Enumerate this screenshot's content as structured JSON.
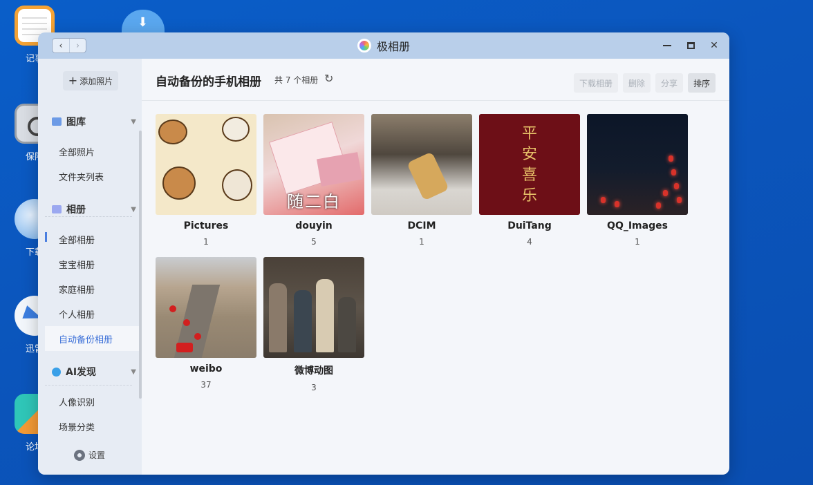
{
  "desktop": {
    "icons": [
      {
        "label": "记事"
      },
      {
        "label": "保险"
      },
      {
        "label": "下载"
      },
      {
        "label": "迅雷"
      },
      {
        "label": "论坛"
      }
    ]
  },
  "window": {
    "title": "极相册",
    "nav": {
      "back": "‹",
      "forward": "›"
    },
    "controls": {
      "close": "✕"
    }
  },
  "sidebar": {
    "add_label": "添加照片",
    "sections": [
      {
        "title": "图库",
        "items": [
          "全部照片",
          "文件夹列表"
        ]
      },
      {
        "title": "相册",
        "items": [
          "全部相册",
          "宝宝相册",
          "家庭相册",
          "个人相册",
          "自动备份相册"
        ]
      },
      {
        "title": "AI发现",
        "items": [
          "人像识别",
          "场景分类"
        ]
      }
    ],
    "active_item": "自动备份相册",
    "settings_label": "设置"
  },
  "main": {
    "title": "自动备份的手机相册",
    "count_text": "共 7 个相册",
    "toolbar": {
      "download": "下载相册",
      "delete": "删除",
      "share": "分享",
      "sort": "排序"
    },
    "albums": [
      {
        "name": "Pictures",
        "count": "1"
      },
      {
        "name": "douyin",
        "count": "5",
        "caption": "随二白"
      },
      {
        "name": "DCIM",
        "count": "1"
      },
      {
        "name": "DuiTang",
        "count": "4",
        "caption": "平安喜乐"
      },
      {
        "name": "QQ_Images",
        "count": "1"
      },
      {
        "name": "weibo",
        "count": "37"
      },
      {
        "name": "微博动图",
        "count": "3"
      }
    ]
  },
  "colors": {
    "accent": "#3a6fd8",
    "titlebar": "#b9cfea",
    "sidebar": "#e7ecf4"
  }
}
